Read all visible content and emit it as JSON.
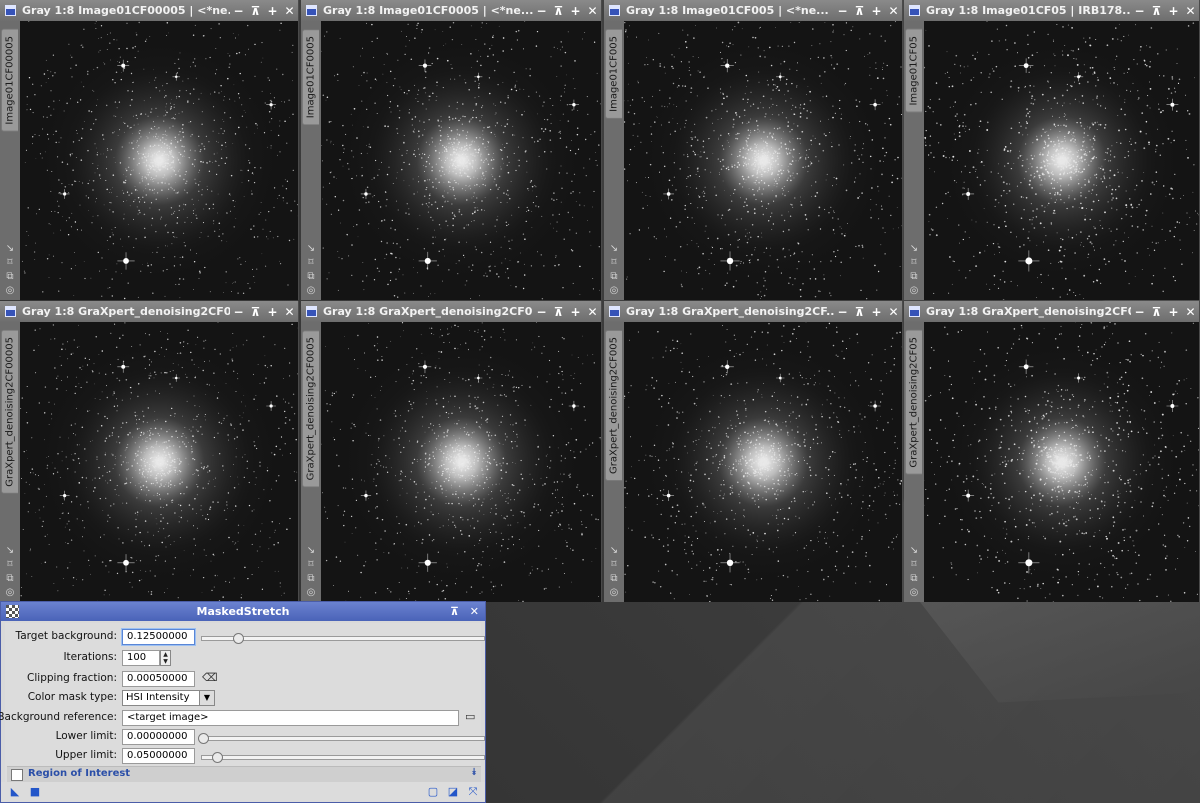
{
  "windows": [
    {
      "title": "Gray 1:8 Image01CF00005 | <*ne...",
      "id": "Image01CF00005",
      "bright": 0.9
    },
    {
      "title": "Gray 1:8 Image01CF0005 | <*ne...",
      "id": "Image01CF0005",
      "bright": 0.95
    },
    {
      "title": "Gray 1:8 Image01CF005 | <*ne...",
      "id": "Image01CF005",
      "bright": 1.0
    },
    {
      "title": "Gray 1:8 Image01CF05 | IRB178...",
      "id": "Image01CF05",
      "bright": 1.1
    },
    {
      "title": "Gray 1:8 GraXpert_denoising2CF0...",
      "id": "GraXpert_denoising2CF00005",
      "bright": 0.9
    },
    {
      "title": "Gray 1:8 GraXpert_denoising2CF0...",
      "id": "GraXpert_denoising2CF0005",
      "bright": 0.95
    },
    {
      "title": "Gray 1:8 GraXpert_denoising2CF...",
      "id": "GraXpert_denoising2CF005",
      "bright": 1.0
    },
    {
      "title": "Gray 1:8 GraXpert_denoising2CF0...",
      "id": "GraXpert_denoising2CF05",
      "bright": 1.1
    }
  ],
  "window_buttons": {
    "minimize": "−",
    "shade": "⊼",
    "maximize": "+",
    "close": "✕"
  },
  "side_icons": [
    "↘",
    "⌑",
    "⧉",
    "◎"
  ],
  "dialog": {
    "title": "MaskedStretch",
    "target_background_label": "Target background:",
    "target_background_value": "0.12500000",
    "target_background_slider": 0.125,
    "iterations_label": "Iterations:",
    "iterations_value": "100",
    "clipping_fraction_label": "Clipping fraction:",
    "clipping_fraction_value": "0.00050000",
    "color_mask_type_label": "Color mask type:",
    "color_mask_type_value": "HSI Intensity",
    "background_reference_label": "Background reference:",
    "background_reference_value": "<target image>",
    "lower_limit_label": "Lower limit:",
    "lower_limit_value": "0.00000000",
    "lower_limit_slider": 0.0,
    "upper_limit_label": "Upper limit:",
    "upper_limit_value": "0.05000000",
    "upper_limit_slider": 0.05,
    "region_of_interest_label": "Region of Interest"
  },
  "colors": {
    "accent": "#4a63b8",
    "roi_text": "#2b4fa8",
    "image_bg": "#141414"
  }
}
